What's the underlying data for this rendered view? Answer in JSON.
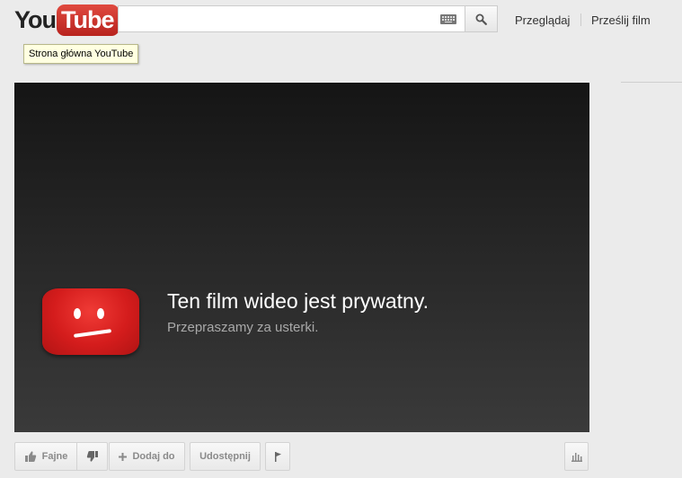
{
  "header": {
    "logo": {
      "you": "You",
      "tube": "Tube"
    },
    "search": {
      "value": "",
      "placeholder": ""
    },
    "nav": {
      "browse": "Przeglądaj",
      "upload": "Prześlij film"
    },
    "tooltip": "Strona główna YouTube"
  },
  "player": {
    "error_title": "Ten film wideo jest prywatny.",
    "error_subtitle": "Przepraszamy za usterki."
  },
  "actions": {
    "like": "Fajne",
    "add_to": "Dodaj do",
    "share": "Udostępnij"
  },
  "icons": {
    "keyboard": "keyboard-icon",
    "search": "search-icon",
    "like": "thumbs-up-icon",
    "dislike": "thumbs-down-icon",
    "add": "plus-icon",
    "flag": "flag-icon",
    "stats": "bar-chart-icon",
    "error": "sad-tv-icon"
  },
  "colors": {
    "brand": "#c4302b",
    "player_bg": "#262626",
    "page_bg": "#ebebeb"
  }
}
